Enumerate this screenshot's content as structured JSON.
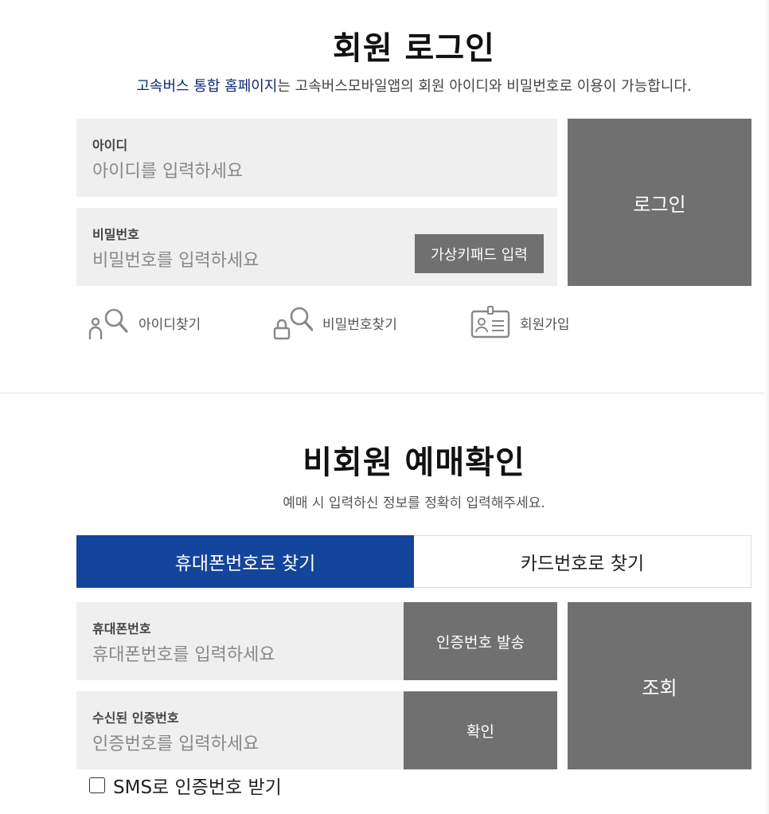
{
  "login": {
    "title": "회원 로그인",
    "desc_highlight": "고속버스 통합 홈페이지",
    "desc_rest": "는 고속버스모바일앱의 회원 아이디와 비밀번호로 이용이 가능합니다.",
    "id_label": "아이디",
    "id_placeholder": "아이디를 입력하세요",
    "pw_label": "비밀번호",
    "pw_placeholder": "비밀번호를 입력하세요",
    "virtual_keypad_label": "가상키패드 입력",
    "login_button": "로그인",
    "links": {
      "find_id": "아이디찾기",
      "find_pw": "비밀번호찾기",
      "join": "회원가입"
    },
    "icons": {
      "find_id": "person-search-icon",
      "find_pw": "lock-search-icon",
      "join": "id-card-icon"
    }
  },
  "guest": {
    "title": "비회원 예매확인",
    "desc": "예매 시 입력하신 정보를 정확히 입력해주세요.",
    "tabs": [
      {
        "label": "휴대폰번호로 찾기",
        "active": true
      },
      {
        "label": "카드번호로 찾기",
        "active": false
      }
    ],
    "phone_label": "휴대폰번호",
    "phone_placeholder": "휴대폰번호를 입력하세요",
    "send_code_button": "인증번호 발송",
    "code_label": "수신된 인증번호",
    "code_placeholder": "인증번호를 입력하세요",
    "confirm_button": "확인",
    "lookup_button": "조회",
    "sms_checkbox_label": "SMS로 인증번호 받기",
    "sms_checked": false
  },
  "colors": {
    "accent": "#12459b",
    "button_gray": "#707070",
    "field_bg": "#efefef",
    "highlight_text": "#0c2a72"
  }
}
